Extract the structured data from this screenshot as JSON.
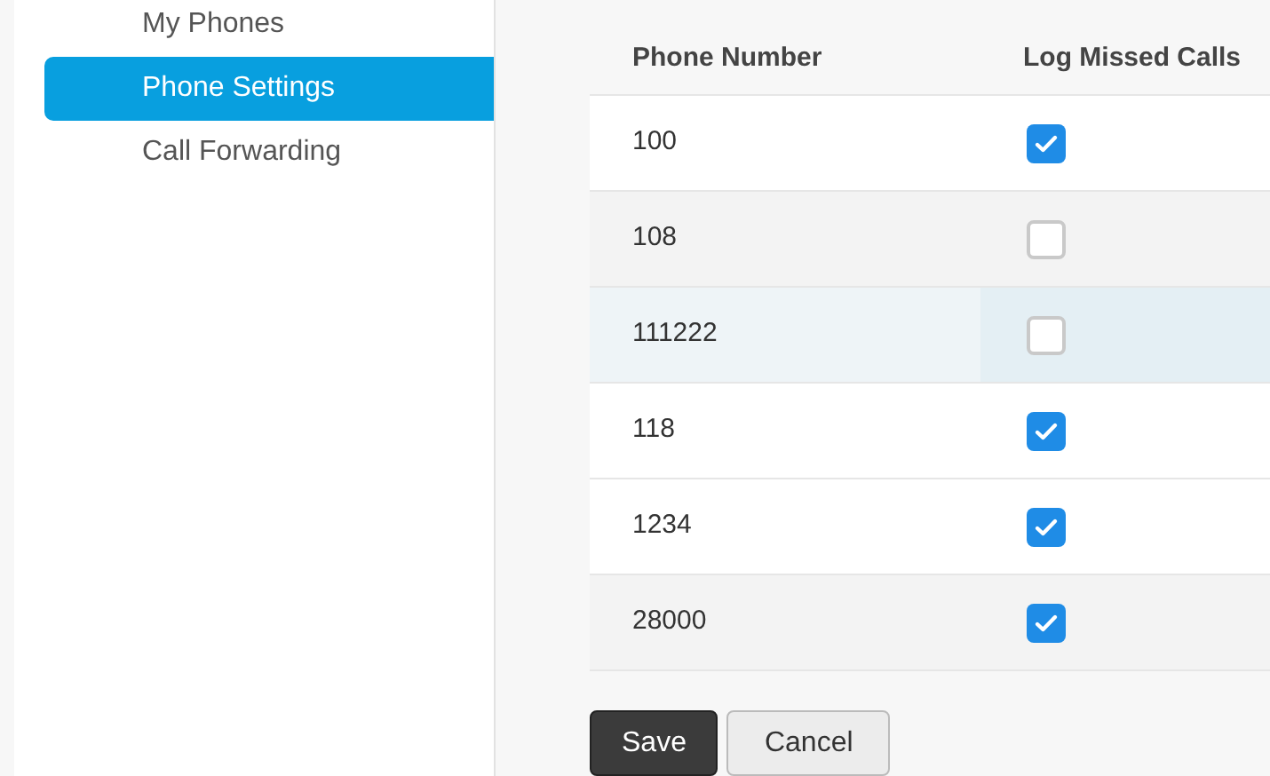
{
  "sidebar": {
    "items": [
      {
        "label": "My Phones",
        "selected": false
      },
      {
        "label": "Phone Settings",
        "selected": true
      },
      {
        "label": "Call Forwarding",
        "selected": false
      }
    ]
  },
  "table": {
    "columns": [
      "Phone Number",
      "Log Missed Calls"
    ],
    "rows": [
      {
        "number": "100",
        "checked": true,
        "shaded": false,
        "hovered": false
      },
      {
        "number": "108",
        "checked": false,
        "shaded": true,
        "hovered": false
      },
      {
        "number": "111222",
        "checked": false,
        "shaded": true,
        "hovered": true
      },
      {
        "number": "118",
        "checked": true,
        "shaded": false,
        "hovered": false
      },
      {
        "number": "1234",
        "checked": true,
        "shaded": false,
        "hovered": false
      },
      {
        "number": "28000",
        "checked": true,
        "shaded": true,
        "hovered": false
      }
    ]
  },
  "buttons": [
    {
      "label": "Save",
      "kind": "primary"
    },
    {
      "label": "Cancel",
      "kind": "secondary"
    }
  ]
}
